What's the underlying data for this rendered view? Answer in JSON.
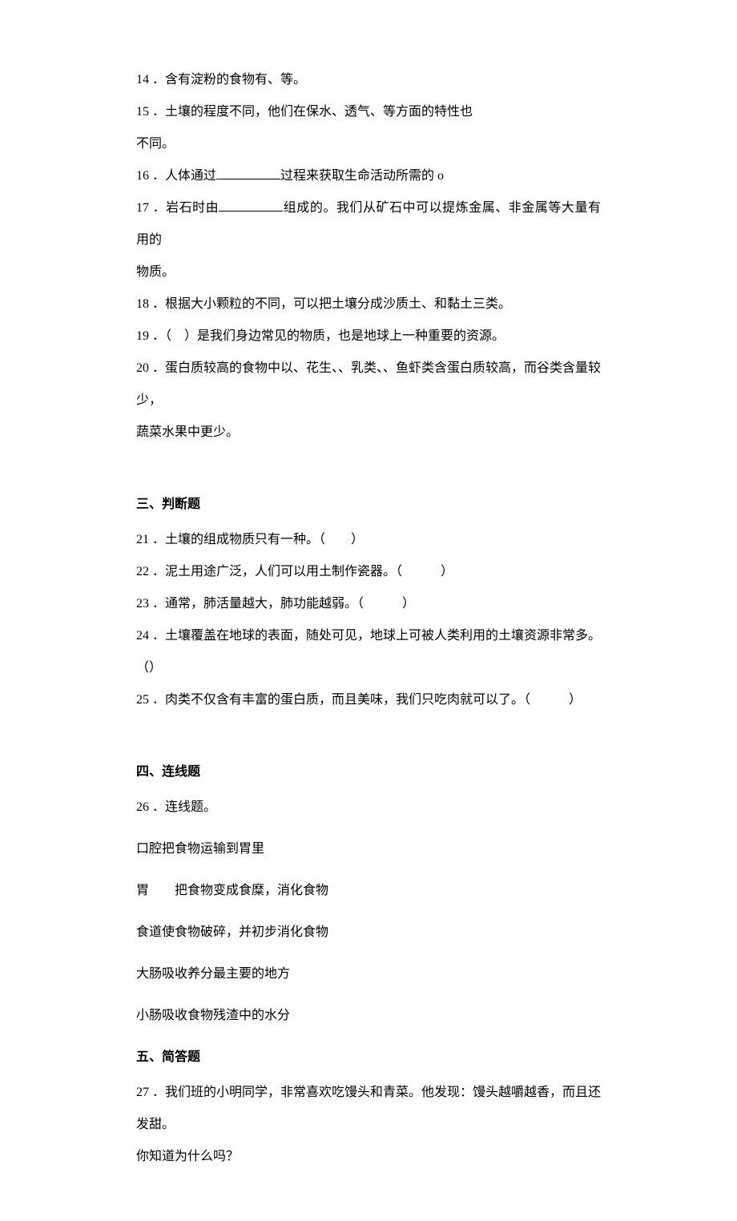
{
  "questions": {
    "q14": {
      "num": "14",
      "text": "．含有淀粉的食物有、等。"
    },
    "q15": {
      "num": "15",
      "text": "．土壤的程度不同，他们在保水、透气、等方面的特性也"
    },
    "q15_cont": "不同。",
    "q16": {
      "num": "16",
      "prefix": "．人体通过",
      "suffix": "过程来获取生命活动所需的 o"
    },
    "q17": {
      "num": "17",
      "prefix": "．岩石时由",
      "suffix": "组成的。我们从矿石中可以提炼金属、非金属等大量有用的"
    },
    "q17_cont": "物质。",
    "q18": {
      "num": "18",
      "text": "．根据大小颗粒的不同，可以把土壤分成沙质土、和黏土三类。"
    },
    "q19": {
      "num": "19",
      "text": "．（　）是我们身边常见的物质，也是地球上一种重要的资源。"
    },
    "q20": {
      "num": "20",
      "text": "．蛋白质较高的食物中以、花生、、乳类、、鱼虾类含蛋白质较高，而谷类含量较少，"
    },
    "q20_cont": "蔬菜水果中更少。"
  },
  "section3": {
    "title": "三、判断题",
    "items": {
      "q21": {
        "num": "21",
        "text": "．土壤的组成物质只有一种。（　　）"
      },
      "q22": {
        "num": "22",
        "text": "．泥土用途广泛，人们可以用土制作瓷器。（　　　）"
      },
      "q23": {
        "num": "23",
        "text": "．通常，肺活量越大，肺功能越弱。（　　　）"
      },
      "q24": {
        "num": "24",
        "text": "．土壤覆盖在地球的表面，随处可见，地球上可被人类利用的土壤资源非常多。"
      },
      "q24_cont": "（）",
      "q25": {
        "num": "25",
        "text": "．肉类不仅含有丰富的蛋白质，而且美味，我们只吃肉就可以了。（　　　）"
      }
    }
  },
  "section4": {
    "title": "四、连线题",
    "q26": {
      "num": "26",
      "text": "．连线题。"
    },
    "lines": [
      "口腔把食物运输到胃里",
      "胃　　把食物变成食糜，消化食物",
      "食道使食物破碎，并初步消化食物",
      "大肠吸收养分最主要的地方",
      "小肠吸收食物残渣中的水分"
    ]
  },
  "section5": {
    "title": "五、简答题",
    "q27": {
      "num": "27",
      "text": "．我们班的小明同学，非常喜欢吃馒头和青菜。他发现：馒头越嚼越香，而且还发甜。"
    },
    "q27_cont": "你知道为什么吗？"
  }
}
